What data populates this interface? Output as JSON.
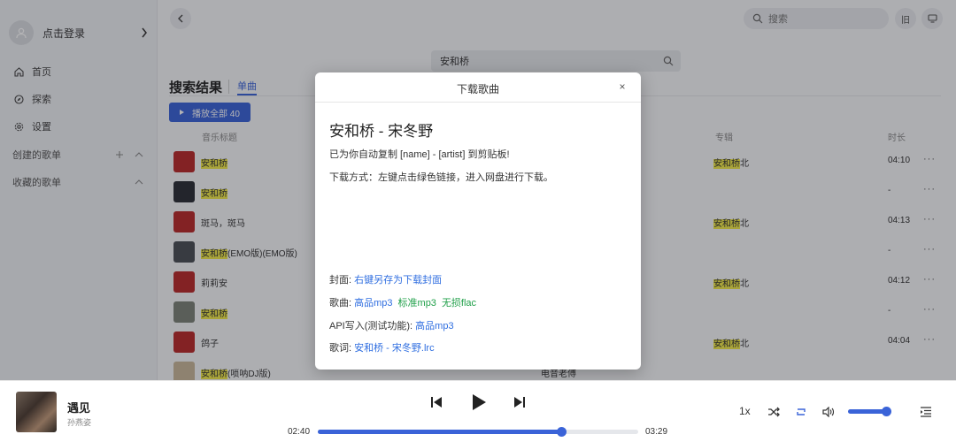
{
  "sidebar": {
    "login_label": "点击登录",
    "nav": [
      {
        "label": "首页",
        "icon": "home-icon"
      },
      {
        "label": "探索",
        "icon": "compass-icon"
      },
      {
        "label": "设置",
        "icon": "gear-icon"
      }
    ],
    "created_playlists_label": "创建的歌单",
    "collected_playlists_label": "收藏的歌单"
  },
  "topbar": {
    "search_placeholder": "搜索",
    "btn1_label": "旧"
  },
  "search": {
    "query": "安和桥"
  },
  "results": {
    "title": "搜索结果",
    "tab_single": "单曲",
    "play_all_label": "播放全部 40",
    "columns": {
      "title": "音乐标题",
      "album": "专辑",
      "duration": "时长"
    },
    "rows": [
      {
        "title_hl": "安和桥",
        "title_rest": "",
        "album_hl": "安和桥",
        "album_rest": "北",
        "duration": "04:10",
        "artist": ""
      },
      {
        "title_hl": "安和桥",
        "title_rest": "",
        "album_hl": "",
        "album_rest": "",
        "duration": "-",
        "artist": ""
      },
      {
        "title_hl": "",
        "title_rest": "斑马，斑马",
        "album_hl": "安和桥",
        "album_rest": "北",
        "duration": "04:13",
        "artist": ""
      },
      {
        "title_hl": "安和桥",
        "title_rest": "(EMO版)(EMO版)",
        "album_hl": "",
        "album_rest": "",
        "duration": "-",
        "artist": ""
      },
      {
        "title_hl": "",
        "title_rest": "莉莉安",
        "album_hl": "安和桥",
        "album_rest": "北",
        "duration": "04:12",
        "artist": ""
      },
      {
        "title_hl": "安和桥",
        "title_rest": "",
        "album_hl": "",
        "album_rest": "",
        "duration": "-",
        "artist": ""
      },
      {
        "title_hl": "",
        "title_rest": "鸽子",
        "album_hl": "安和桥",
        "album_rest": "北",
        "duration": "04:04",
        "artist": ""
      },
      {
        "title_hl": "安和桥",
        "title_rest": "(唢呐DJ版)",
        "album_hl": "",
        "album_rest": "",
        "duration": "",
        "artist": "电音老傅"
      }
    ],
    "more_label": "···"
  },
  "modal": {
    "title": "下载歌曲",
    "close_label": "×",
    "song_heading": "安和桥 - 宋冬野",
    "copy_note": "已为你自动复制 [name] - [artist] 到剪贴板!",
    "method_note": "下载方式：左键点击绿色链接，进入网盘进行下载。",
    "cover_label": "封面: ",
    "cover_link": "右键另存为下载封面",
    "song_label": "歌曲: ",
    "song_links": [
      "高品mp3",
      "标准mp3",
      "无损flac"
    ],
    "api_label": "API写入(测试功能): ",
    "api_link": "高品mp3",
    "lyrics_label": "歌词: ",
    "lyrics_link": "安和桥 - 宋冬野.lrc"
  },
  "player": {
    "title": "遇见",
    "artist": "孙燕姿",
    "time_current": "02:40",
    "time_total": "03:29",
    "progress_fraction": 0.76,
    "speed_label": "1x",
    "volume_fraction": 0.9
  },
  "colors": {
    "accent": "#3a63d8",
    "highlight": "#f1e94a",
    "link_blue": "#2f6ee0",
    "link_green": "#21a04a"
  }
}
